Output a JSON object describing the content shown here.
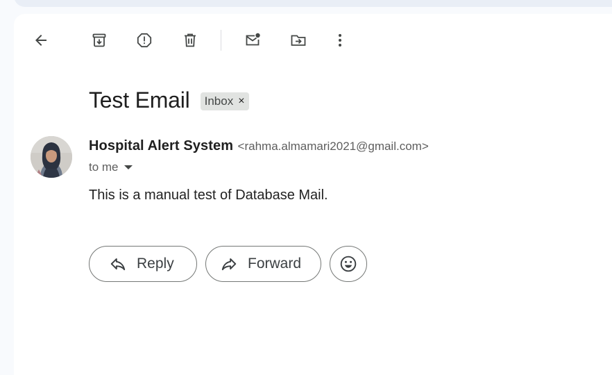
{
  "toolbar": {
    "icons": [
      "back-arrow-icon",
      "archive-icon",
      "report-spam-icon",
      "delete-icon",
      "mark-unread-icon",
      "move-to-icon",
      "more-vert-icon"
    ]
  },
  "email": {
    "subject": "Test Email",
    "label": "Inbox",
    "label_remove": "×",
    "sender_name": "Hospital Alert System",
    "sender_email": "<rahma.almamari2021@gmail.com>",
    "recipient": "to me",
    "body": "This is a manual test of Database Mail."
  },
  "actions": {
    "reply_label": "Reply",
    "forward_label": "Forward",
    "emoji_icon": "emoji-reaction-icon"
  }
}
